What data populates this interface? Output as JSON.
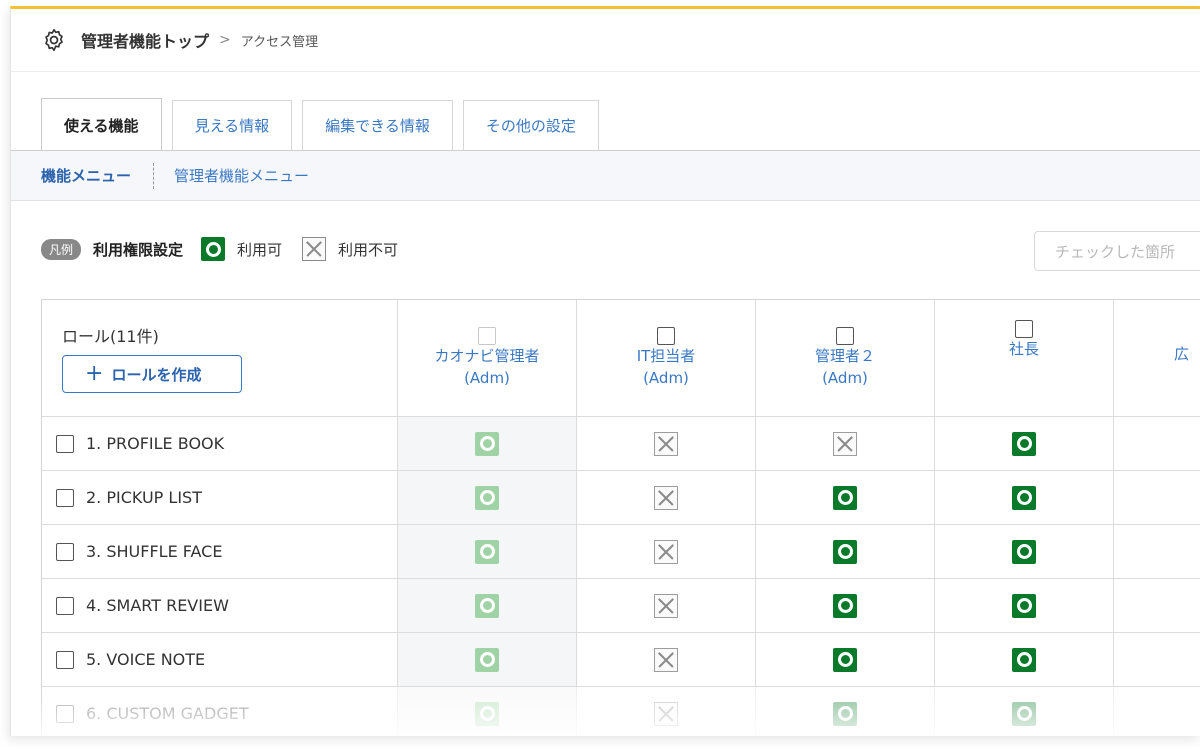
{
  "breadcrumb": {
    "main": "管理者機能トップ",
    "sep": ">",
    "sub": "アクセス管理"
  },
  "tabs": [
    {
      "label": "使える機能",
      "active": true
    },
    {
      "label": "見える情報",
      "active": false
    },
    {
      "label": "編集できる情報",
      "active": false
    },
    {
      "label": "その他の設定",
      "active": false
    }
  ],
  "subnav": {
    "active": "機能メニュー",
    "other": "管理者機能メニュー"
  },
  "legend": {
    "badge": "凡例",
    "title": "利用権限設定",
    "ok_label": "利用可",
    "ng_label": "利用不可"
  },
  "check_button": "チェックした箇所",
  "table": {
    "role_count": "ロール(11件)",
    "create_button": "ロールを作成",
    "columns": [
      {
        "name": "カオナビ管理者",
        "sub": "(Adm)"
      },
      {
        "name": "IT担当者",
        "sub": "(Adm)"
      },
      {
        "name": "管理者２",
        "sub": "(Adm)"
      },
      {
        "name": "社長",
        "sub": ""
      },
      {
        "name": "広",
        "sub": ""
      }
    ],
    "rows": [
      {
        "label": "1. PROFILE BOOK",
        "values": [
          "ok-light",
          "ng",
          "ng",
          "ok"
        ]
      },
      {
        "label": "2. PICKUP LIST",
        "values": [
          "ok-light",
          "ng",
          "ok",
          "ok"
        ]
      },
      {
        "label": "3. SHUFFLE FACE",
        "values": [
          "ok-light",
          "ng",
          "ok",
          "ok"
        ]
      },
      {
        "label": "4. SMART REVIEW",
        "values": [
          "ok-light",
          "ng",
          "ok",
          "ok"
        ]
      },
      {
        "label": "5. VOICE NOTE",
        "values": [
          "ok-light",
          "ng",
          "ok",
          "ok"
        ]
      },
      {
        "label": "6. CUSTOM GADGET",
        "values": [
          "ok-light",
          "ng",
          "ok",
          "ok"
        ]
      }
    ]
  },
  "colors": {
    "accent_top": "#f1c232",
    "ok": "#0a7a2a",
    "ok_light": "#9fd3a5",
    "link": "#3b78c3"
  }
}
